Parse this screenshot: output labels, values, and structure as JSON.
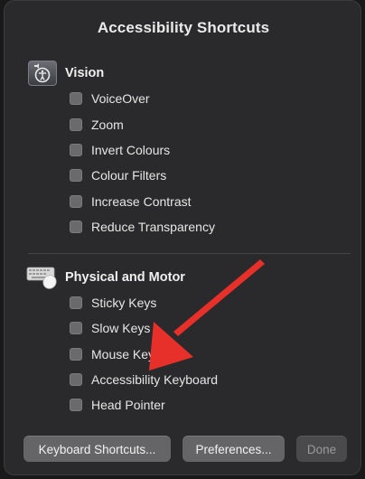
{
  "window": {
    "title": "Accessibility Shortcuts"
  },
  "vision": {
    "heading": "Vision",
    "icon": "accessibility-icon",
    "items": [
      {
        "label": "VoiceOver",
        "checked": false
      },
      {
        "label": "Zoom",
        "checked": false
      },
      {
        "label": "Invert Colours",
        "checked": false
      },
      {
        "label": "Colour Filters",
        "checked": false
      },
      {
        "label": "Increase Contrast",
        "checked": false
      },
      {
        "label": "Reduce Transparency",
        "checked": false
      }
    ]
  },
  "motor": {
    "heading": "Physical and Motor",
    "icon": "keyboard-mouse-icon",
    "items": [
      {
        "label": "Sticky Keys",
        "checked": false
      },
      {
        "label": "Slow Keys",
        "checked": false
      },
      {
        "label": "Mouse Keys",
        "checked": false
      },
      {
        "label": "Accessibility Keyboard",
        "checked": false
      },
      {
        "label": "Head Pointer",
        "checked": false
      }
    ]
  },
  "buttons": {
    "keyboard_shortcuts": "Keyboard Shortcuts...",
    "preferences": "Preferences...",
    "done": "Done"
  },
  "annotation": {
    "arrow_color": "#e8302a",
    "points_to": "Accessibility Keyboard"
  }
}
